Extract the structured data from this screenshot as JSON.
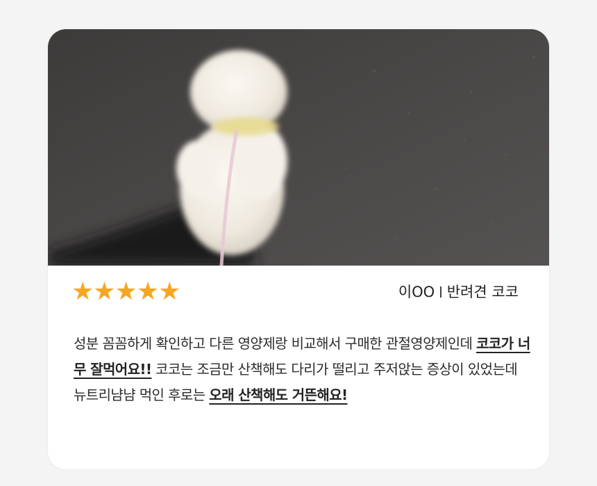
{
  "review_card": {
    "photo": {
      "subject": "white fluffy dog on leash walking on asphalt"
    },
    "rating": {
      "stars_text": "★★★★★",
      "value": 5,
      "max": 5,
      "color": "#f7a623"
    },
    "author": {
      "name": "이OO",
      "pet": "반려견 코코"
    },
    "review": {
      "part1": "성분 꼼꼼하게 확인하고 다른 영양제랑 비교해서 구매한 관절영양제인데 ",
      "highlight1": "코코가 너무 잘먹어요!!",
      "part2": " 코코는 조금만 산책해도 다리가 떨리고 주저앉는 증상이 있었는데 뉴트리냠냠 먹인 후로는 ",
      "highlight2": "오래 산책해도 거뜬해요!"
    }
  }
}
